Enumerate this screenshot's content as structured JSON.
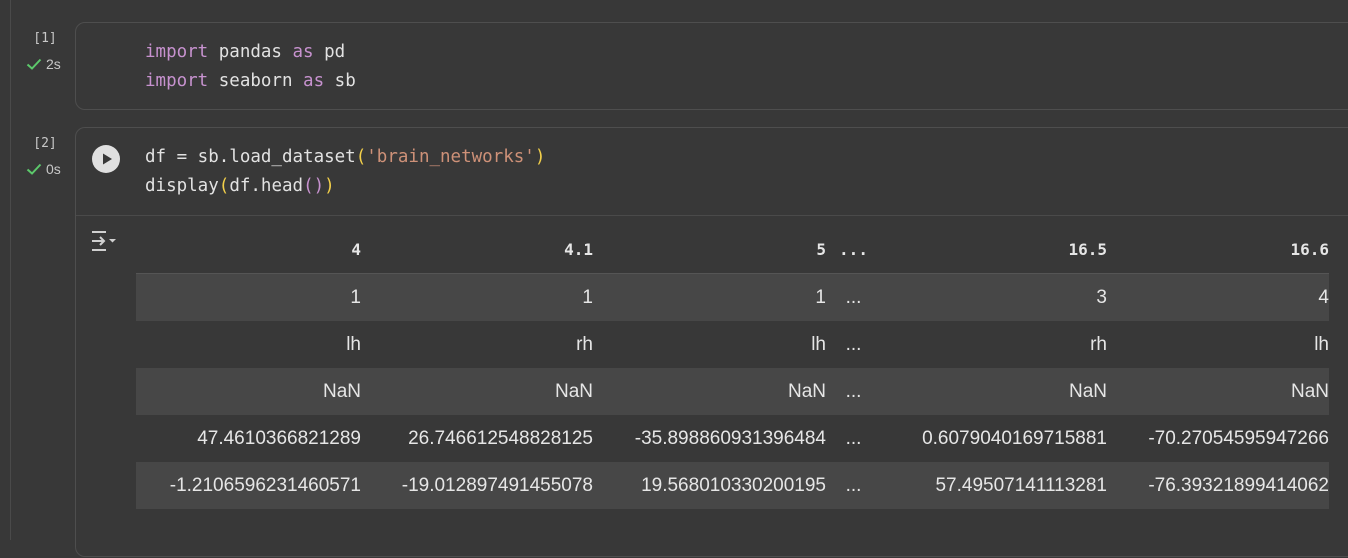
{
  "cells": [
    {
      "exec_count": "[1]",
      "status_time": "2s",
      "code_lines": [
        {
          "kw1": "import",
          "mid": " pandas ",
          "kw2": "as",
          "rest": " pd"
        },
        {
          "kw1": "import",
          "mid": " seaborn ",
          "kw2": "as",
          "rest": " sb"
        }
      ]
    },
    {
      "exec_count": "[2]",
      "status_time": "0s",
      "line1": {
        "a": "df = sb.load_dataset",
        "p1": "(",
        "s": "'brain_networks'",
        "p2": ")"
      },
      "line2": {
        "a": "display",
        "p1": "(",
        "b": "df.head",
        "p3": "()",
        "p2": ")"
      }
    }
  ],
  "table": {
    "headers": [
      "4",
      "4.1",
      "5",
      "...",
      "16.5",
      "16.6"
    ],
    "rows": [
      [
        "1",
        "1",
        "1",
        "...",
        "3",
        "4"
      ],
      [
        "lh",
        "rh",
        "lh",
        "...",
        "rh",
        "lh"
      ],
      [
        "NaN",
        "NaN",
        "NaN",
        "...",
        "NaN",
        "NaN"
      ],
      [
        "47.4610366821289",
        "26.746612548828125",
        "-35.898860931396484",
        "...",
        "0.6079040169715881",
        "-70.27054595947266"
      ],
      [
        "-1.2106596231460571",
        "-19.012897491455078",
        "19.568010330200195",
        "...",
        "57.49507141113281",
        "-76.39321899414062"
      ]
    ]
  },
  "icons": {
    "check_color": "#5cc96b",
    "run": "play-icon",
    "output": "output-toggle-icon"
  }
}
